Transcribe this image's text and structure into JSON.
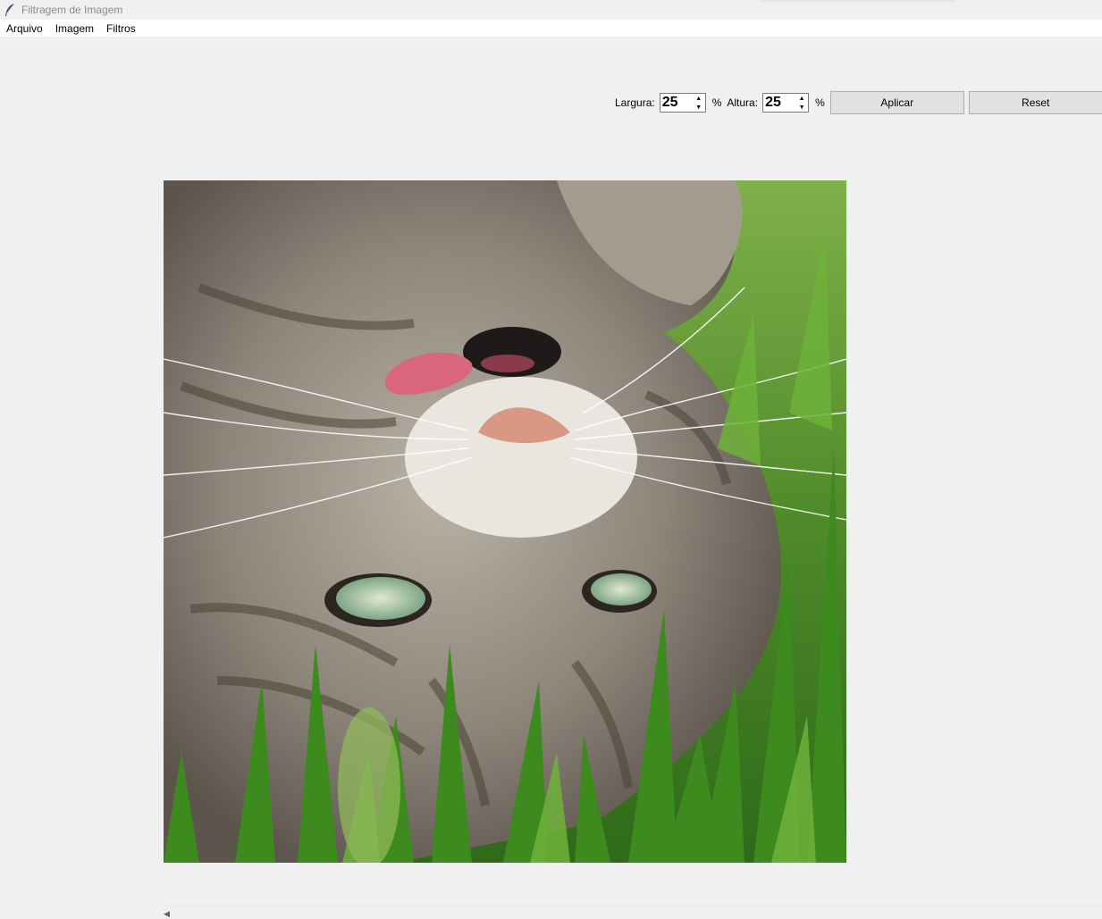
{
  "window": {
    "title": "Filtragem de Imagem",
    "icon": "feather-icon"
  },
  "menu": {
    "items": [
      "Arquivo",
      "Imagem",
      "Filtros"
    ]
  },
  "controls": {
    "width_label": "Largura:",
    "width_value": "25",
    "width_unit": "%",
    "height_label": "Altura:",
    "height_value": "25",
    "height_unit": "%",
    "apply_label": "Aplicar",
    "reset_label": "Reset"
  },
  "image": {
    "subject": "tabby-cat-lying-in-grass",
    "colors": {
      "grass": "#4f8a2a",
      "fur": "#8d857a",
      "tongue": "#d9667a",
      "nose": "#d99884",
      "eye": "#a9c3a0"
    }
  },
  "scrollbar": {
    "left_arrow": "◀"
  }
}
